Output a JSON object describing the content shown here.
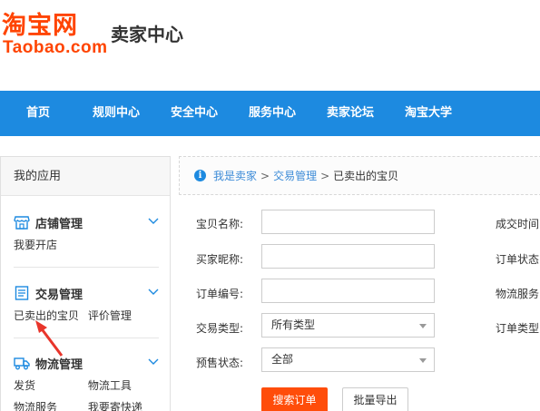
{
  "logo": {
    "cn": "淘宝网",
    "en": "Taobao.com",
    "color": "#ff4400"
  },
  "header": {
    "title": "卖家中心"
  },
  "nav": {
    "color": "#1d8ae0",
    "items": [
      {
        "label": "首页"
      },
      {
        "label": "规则中心"
      },
      {
        "label": "安全中心"
      },
      {
        "label": "服务中心"
      },
      {
        "label": "卖家论坛"
      },
      {
        "label": "淘宝大学"
      }
    ]
  },
  "sidebar": {
    "header": "我的应用",
    "sections": [
      {
        "title": "店铺管理",
        "icon": "store-icon",
        "links": [
          "我要开店"
        ]
      },
      {
        "title": "交易管理",
        "icon": "order-list-icon",
        "links": [
          "已卖出的宝贝",
          "评价管理"
        ]
      },
      {
        "title": "物流管理",
        "icon": "truck-icon",
        "links": [
          "发货",
          "物流工具"
        ],
        "links2": [
          "物流服务",
          "我要寄快递"
        ]
      }
    ]
  },
  "breadcrumb": {
    "items": [
      "我是卖家",
      "交易管理"
    ],
    "current": "已卖出的宝贝",
    "separator": ">"
  },
  "form": {
    "item_name_label": "宝贝名称:",
    "buyer_nick_label": "买家昵称:",
    "order_no_label": "订单编号:",
    "trade_type_label": "交易类型:",
    "trade_type_value": "所有类型",
    "presale_label": "预售状态:",
    "presale_value": "全部",
    "right_labels": [
      "成交时间",
      "订单状态",
      "物流服务",
      "订单类型"
    ]
  },
  "buttons": {
    "search": "搜索订单",
    "export": "批量导出",
    "search_color": "#ff4d0a"
  }
}
